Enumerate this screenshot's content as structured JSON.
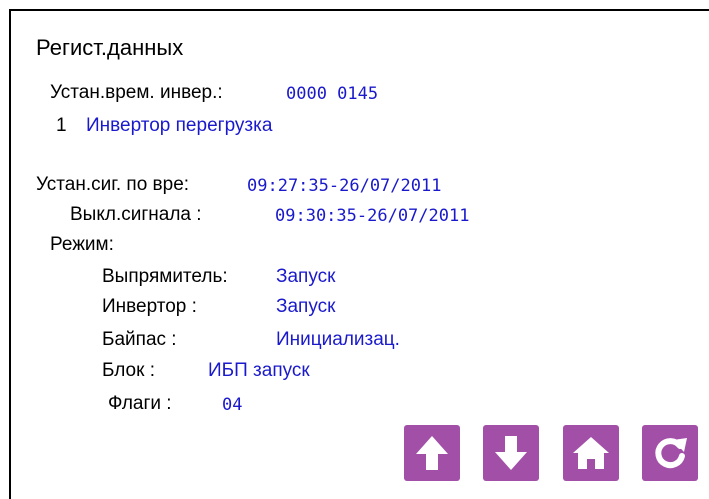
{
  "screen": {
    "title": "Регист.данных",
    "inv_time_label": "Устан.врем. инвер.:",
    "inv_time_value": "0000 0145",
    "event_number": "1",
    "event_text": "Инвертор перегрузка",
    "alarm_on_label": "Устан.сиг. по вре:",
    "alarm_on_value": "09:27:35-26/07/2011",
    "alarm_off_label": "Выкл.сигнала :",
    "alarm_off_value": "09:30:35-26/07/2011",
    "mode_label": "Режим:",
    "modes": [
      {
        "label": "Выпрямитель:",
        "value": "Запуск"
      },
      {
        "label": "Инвертор     :",
        "value": "Запуск"
      },
      {
        "label": "Байпас     :",
        "value": "Инициализац."
      },
      {
        "label": "Блок      :",
        "value": "ИБП запуск"
      },
      {
        "label": "Флаги     :",
        "value": "04"
      }
    ]
  },
  "buttons": {
    "up": "arrow-up-icon",
    "down": "arrow-down-icon",
    "home": "home-icon",
    "refresh": "refresh-icon",
    "color": "#a24fa8"
  },
  "colors": {
    "value_text": "#1a1acc",
    "label_text": "#000000"
  }
}
